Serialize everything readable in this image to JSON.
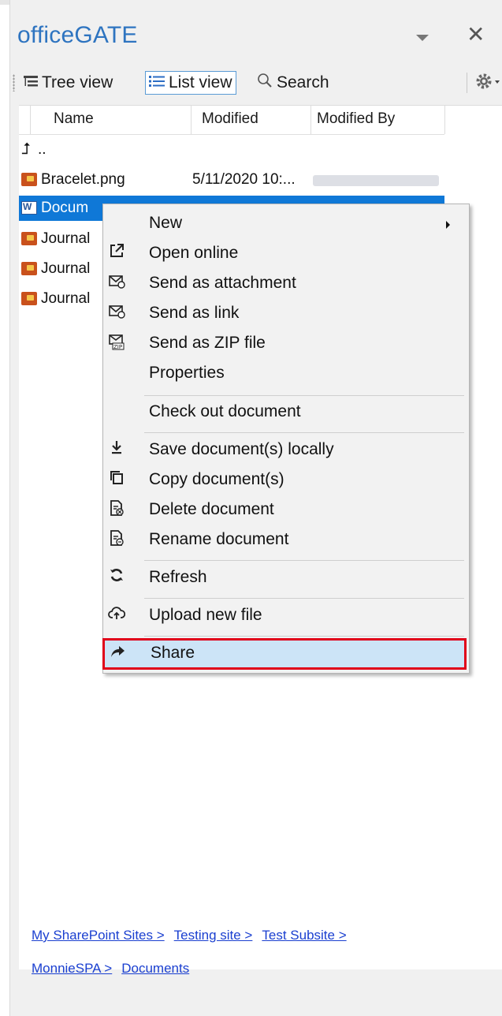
{
  "pane": {
    "title": "officeGATE",
    "close_glyph": "✕"
  },
  "toolbar": {
    "tree_view": "Tree view",
    "list_view": "List view",
    "search": "Search"
  },
  "list": {
    "columns": [
      "Name",
      "Modified",
      "Modified By"
    ],
    "parent_row": "..",
    "rows": [
      {
        "name": "Bracelet.png",
        "modified": "5/11/2020 10:...",
        "icon": "image-file-icon"
      },
      {
        "name": "Docum",
        "modified": "",
        "icon": "word-file-icon",
        "selected": true
      },
      {
        "name": "Journal",
        "modified": "",
        "icon": "image-file-icon"
      },
      {
        "name": "Journal",
        "modified": "",
        "icon": "image-file-icon"
      },
      {
        "name": "Journal",
        "modified": "",
        "icon": "image-file-icon"
      }
    ]
  },
  "context_menu": {
    "new": "New",
    "open_online": "Open online",
    "send_attachment": "Send as attachment",
    "send_link": "Send as link",
    "send_zip": "Send as ZIP file",
    "properties": "Properties",
    "check_out": "Check out document",
    "save_locally": "Save document(s) locally",
    "copy": "Copy document(s)",
    "delete": "Delete document",
    "rename": "Rename document",
    "refresh": "Refresh",
    "upload": "Upload new file",
    "share": "Share"
  },
  "breadcrumb": {
    "my_sites": "My SharePoint Sites >",
    "testing_site": "Testing site >",
    "test_subsite": "Test Subsite >",
    "monniespa": "MonnieSPA >",
    "documents": "Documents"
  },
  "colors": {
    "title": "#2e74c0",
    "selection": "#0f78d7",
    "menu_highlight": "#cce4f7",
    "highlight_border": "#e0001a",
    "link": "#1a3fd0"
  }
}
